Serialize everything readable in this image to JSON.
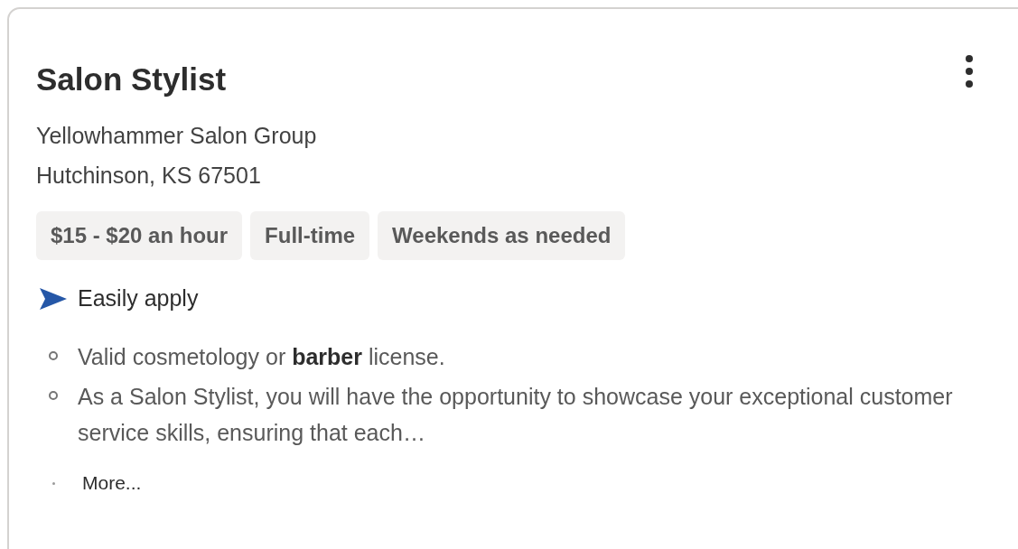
{
  "job": {
    "title": "Salon Stylist",
    "company": "Yellowhammer Salon Group",
    "location": "Hutchinson, KS 67501",
    "tags": [
      "$15 - $20 an hour",
      "Full-time",
      "Weekends as needed"
    ],
    "apply": "Easily apply",
    "bullets": [
      "Valid cosmetology or **barber** license.",
      "As a Salon Stylist, you will have the opportunity to showcase your exceptional customer service skills, ensuring that each…"
    ],
    "more": "More..."
  }
}
